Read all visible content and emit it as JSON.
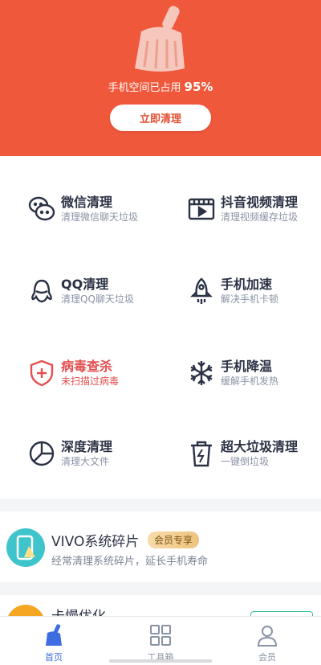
{
  "header": {
    "storage_label": "手机空间已占用",
    "storage_percent": "95%",
    "clean_button": "立即清理",
    "accent_color": "#f0583b"
  },
  "features": [
    {
      "title": "微信清理",
      "subtitle": "清理微信聊天垃圾",
      "icon": "wechat-icon"
    },
    {
      "title": "抖音视频清理",
      "subtitle": "清理视频缓存垃圾",
      "icon": "video-icon"
    },
    {
      "title": "QQ清理",
      "subtitle": "清理QQ聊天垃圾",
      "icon": "qq-icon"
    },
    {
      "title": "手机加速",
      "subtitle": "解决手机卡顿",
      "icon": "rocket-icon"
    },
    {
      "title": "病毒查杀",
      "subtitle": "未扫描过病毒",
      "icon": "shield-icon",
      "warning_color": "#e34f4f"
    },
    {
      "title": "手机降温",
      "subtitle": "缓解手机发热",
      "icon": "snowflake-icon"
    },
    {
      "title": "深度清理",
      "subtitle": "清理大文件",
      "icon": "pie-chart-icon"
    },
    {
      "title": "超大垃圾清理",
      "subtitle": "一键倒垃圾",
      "icon": "trash-icon"
    }
  ],
  "vivo_card": {
    "title": "VIVO系统碎片",
    "badge": "会员专享",
    "subtitle": "经常清理系统碎片，延长手机寿命"
  },
  "peek_card": {
    "title": "卡慢优化"
  },
  "tabbar": [
    {
      "label": "首页",
      "icon": "broom-icon",
      "active": true
    },
    {
      "label": "工具箱",
      "icon": "grid-icon",
      "active": false
    },
    {
      "label": "会员",
      "icon": "user-icon",
      "active": false
    }
  ]
}
